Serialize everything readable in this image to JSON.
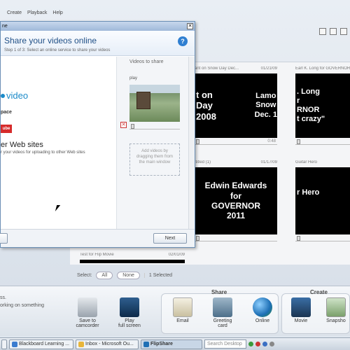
{
  "menubar": {
    "items": [
      "Create",
      "Playback",
      "Help"
    ]
  },
  "library": {
    "tiles": [
      {
        "title": "ant on Snow Day Dec...",
        "date": "01/21/09",
        "caption": "t on\nDay\n2008",
        "duration": ""
      },
      {
        "title": "",
        "date": "",
        "caption": "Lamo\nSnow\nDec. 1",
        "duration": "0:48"
      },
      {
        "title": "Earl K. Long for GOVERNOR",
        "date": "",
        "caption": ". Long\nr\nRNOR\nt crazy\"",
        "duration": ""
      },
      {
        "title": "ititled (1)",
        "date": "01/17/09",
        "caption": "Edwin Edwards\nfor\nGOVERNOR\n2011",
        "duration": ""
      },
      {
        "title": "Guitar Hero",
        "date": "",
        "caption": "r Hero",
        "duration": ""
      }
    ],
    "bottom_tile": {
      "title": "Test for Flip Movie",
      "date": "02/01/09"
    }
  },
  "selection": {
    "label": "Select:",
    "all": "All",
    "none": "None",
    "count": "1 Selected"
  },
  "actions": {
    "status": [
      "ss.",
      "orking on something"
    ],
    "left": [
      {
        "label": "Save to\ncamcorder",
        "icon": "save-to-camcorder-icon"
      },
      {
        "label": "Play\nfull screen",
        "icon": "play-fullscreen-icon"
      }
    ],
    "share_title": "Share",
    "share": [
      {
        "label": "Email",
        "icon": "email-icon"
      },
      {
        "label": "Greeting\ncard",
        "icon": "greeting-card-icon"
      },
      {
        "label": "Online",
        "icon": "online-globe-icon"
      }
    ],
    "create_title": "Create",
    "create": [
      {
        "label": "Movie",
        "icon": "movie-clapper-icon"
      },
      {
        "label": "Snapsho",
        "icon": "snapshot-icon"
      }
    ]
  },
  "dialog": {
    "title": "Share your videos online",
    "step": "Step 1 of 3: Select an online service to share your videos",
    "services": {
      "vimeo": "video",
      "myspace": "pace",
      "youtube": "ube",
      "other": "er Web sites",
      "other_desc": "r your videos for uploading to other Web sites"
    },
    "videos_to_share": "Videos to share",
    "clip_label": "play",
    "drop_hint": "Add videos by dragging them from the main window",
    "back": "",
    "next": "Next"
  },
  "taskbar": {
    "tasks": [
      {
        "label": "Blackboard Learning ...",
        "icon": "ie-icon"
      },
      {
        "label": "Inbox - Microsoft Ou...",
        "icon": "outlook-icon"
      },
      {
        "label": "FlipShare",
        "icon": "flipshare-icon"
      }
    ],
    "search_placeholder": "Search Desktop"
  },
  "colors": {
    "accent": "#1f4f86",
    "help": "#2f7fd1",
    "youtube": "#d62b2b",
    "vimeo": "#1a8ac9"
  }
}
